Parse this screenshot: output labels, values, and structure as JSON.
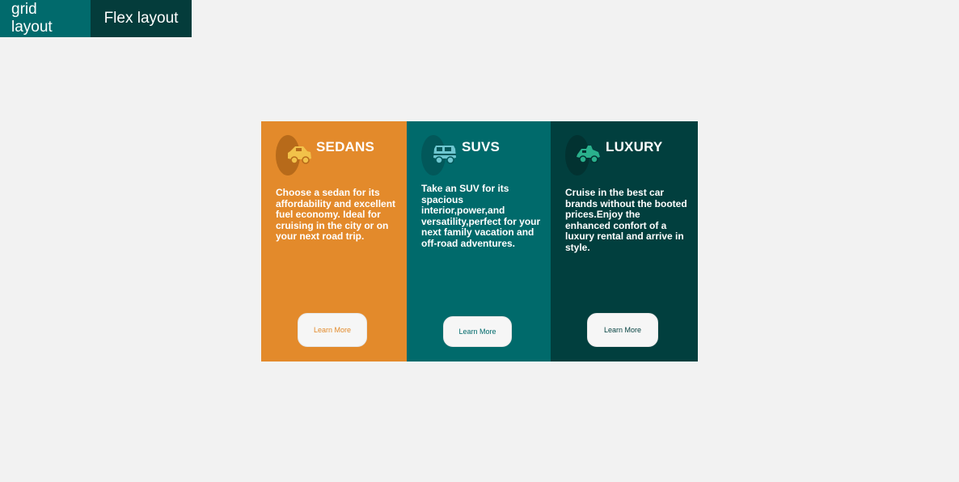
{
  "tabs": [
    {
      "label": "grid layout",
      "color": "#016a6c"
    },
    {
      "label": "Flex layout",
      "color": "#043c3b"
    }
  ],
  "cards": [
    {
      "title": "SEDANS",
      "icon": "sedan-car-icon",
      "text": "Choose a sedan for its affordability and excellent fuel economy. Ideal for cruising in the city or on your next road trip.",
      "button": "Learn More",
      "color": "#e38a2b"
    },
    {
      "title": "SUVS",
      "icon": "suv-car-icon",
      "text": "Take an SUV for its spacious interior,power,and versatility,perfect for your next family vacation and off-road adventures.",
      "button": "Learn More",
      "color": "#006a6b"
    },
    {
      "title": "LUXURY",
      "icon": "luxury-car-icon",
      "text": "Cruise in the best car brands without the booted prices.Enjoy the enhanced confort of a luxury rental and arrive in style.",
      "button": "Learn More",
      "color": "#013f3e"
    }
  ]
}
